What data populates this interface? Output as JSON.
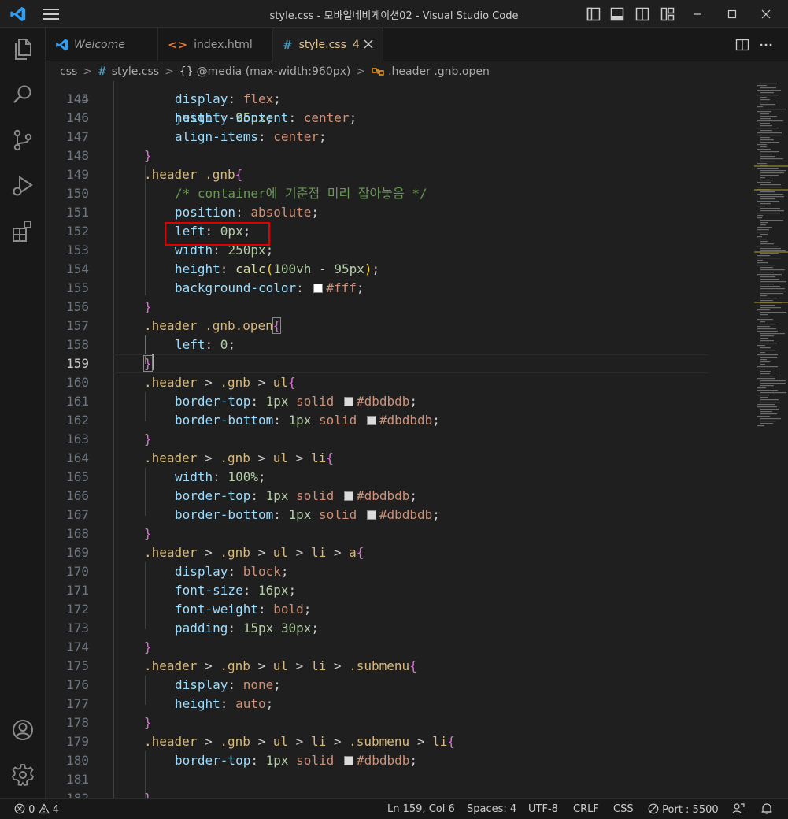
{
  "window": {
    "title": "style.css - 모바일네비게이션02 - Visual Studio Code"
  },
  "tabs": [
    {
      "label": "Welcome",
      "icon": "vscode-icon"
    },
    {
      "label": "index.html",
      "icon": "html-file-icon"
    },
    {
      "label": "style.css",
      "icon": "css-file-icon",
      "badge": "4",
      "active": true
    }
  ],
  "breadcrumb": {
    "folder": "css",
    "file": "style.css",
    "media": "@media (max-width:960px)",
    "rule": ".header .gnb.open"
  },
  "editor": {
    "current_line": 159,
    "partial_top_line": "144",
    "partial_top_text": "height: 95px;",
    "partial_bottom_line": "182",
    "lines": [
      {
        "n": "145",
        "text": "display: flex;"
      },
      {
        "n": "146",
        "text": "justify-content: center;"
      },
      {
        "n": "147",
        "text": "align-items: center;"
      },
      {
        "n": "148",
        "text": "}"
      },
      {
        "n": "149",
        "text": ".header .gnb{"
      },
      {
        "n": "150",
        "text": "/* container에 기준점 미리 잡아놓음 */"
      },
      {
        "n": "151",
        "text": "position: absolute;"
      },
      {
        "n": "152",
        "text": "left: 0px;"
      },
      {
        "n": "153",
        "text": "width: 250px;"
      },
      {
        "n": "154",
        "text": "height: calc(100vh - 95px);"
      },
      {
        "n": "155",
        "text": "background-color: #fff;"
      },
      {
        "n": "156",
        "text": "}"
      },
      {
        "n": "157",
        "text": ".header .gnb.open{"
      },
      {
        "n": "158",
        "text": "left: 0;"
      },
      {
        "n": "159",
        "text": "}"
      },
      {
        "n": "160",
        "text": ".header > .gnb > ul{"
      },
      {
        "n": "161",
        "text": "border-top: 1px solid #dbdbdb;"
      },
      {
        "n": "162",
        "text": "border-bottom: 1px solid #dbdbdb;"
      },
      {
        "n": "163",
        "text": "}"
      },
      {
        "n": "164",
        "text": ".header > .gnb > ul > li{"
      },
      {
        "n": "165",
        "text": "width: 100%;"
      },
      {
        "n": "166",
        "text": "border-top: 1px solid #dbdbdb;"
      },
      {
        "n": "167",
        "text": "border-bottom: 1px solid #dbdbdb;"
      },
      {
        "n": "168",
        "text": "}"
      },
      {
        "n": "169",
        "text": ".header > .gnb > ul > li > a{"
      },
      {
        "n": "170",
        "text": "display: block;"
      },
      {
        "n": "171",
        "text": "font-size: 16px;"
      },
      {
        "n": "172",
        "text": "font-weight: bold;"
      },
      {
        "n": "173",
        "text": "padding: 15px 30px;"
      },
      {
        "n": "174",
        "text": "}"
      },
      {
        "n": "175",
        "text": ".header > .gnb > ul > li > .submenu{"
      },
      {
        "n": "176",
        "text": "display: none;"
      },
      {
        "n": "177",
        "text": "height: auto;"
      },
      {
        "n": "178",
        "text": "}"
      },
      {
        "n": "179",
        "text": ".header > .gnb > ul > li > .submenu > li{"
      },
      {
        "n": "180",
        "text": "border-top: 1px solid #dbdbdb;"
      },
      {
        "n": "181",
        "text": ""
      }
    ]
  },
  "statusbar": {
    "errors": "0",
    "warnings": "4",
    "position": "Ln 159, Col 6",
    "spaces": "Spaces: 4",
    "encoding": "UTF-8",
    "eol": "CRLF",
    "language": "CSS",
    "port": "Port : 5500"
  },
  "colors": {
    "accent": "#0078d4",
    "highlight_box": "#e00000",
    "selector": "#d7ba7d",
    "property": "#9cdcfe",
    "value": "#ce9178",
    "number": "#b5cea8",
    "comment": "#6a9955"
  }
}
